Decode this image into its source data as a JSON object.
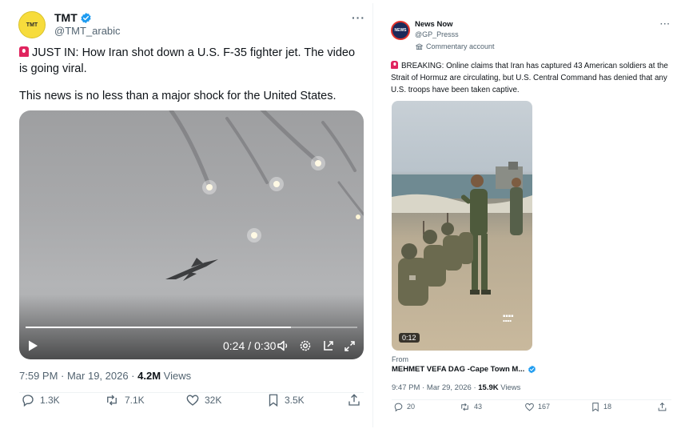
{
  "left_post": {
    "author_name": "TMT",
    "author_handle": "@TMT_arabic",
    "avatar_text": "TMT",
    "verified_color": "#1d9bf0",
    "text_line1": "JUST IN: How Iran shot down a U.S. F-35 fighter jet. The video is going viral.",
    "text_line2": "This news is no less than a major shock for the United States.",
    "video": {
      "elapsed": "0:24",
      "separator": "/",
      "duration": "0:30",
      "progress": 0.8
    },
    "timestamp": "7:59 PM · Mar 19, 2026 · ",
    "views_count": "4.2M",
    "views_label": " Views",
    "actions": {
      "replies": "1.3K",
      "reposts": "7.1K",
      "likes": "32K",
      "bookmarks": "3.5K"
    }
  },
  "right_post": {
    "author_name": "News Now",
    "author_handle": "@GP_Presss",
    "account_label": "Commentary account",
    "avatar_text": "NEWS",
    "text": "BREAKING: Online claims that Iran has captured 43 American soldiers at the Strait of Hormuz are circulating, but U.S. Central Command has denied that any U.S. troops have been taken captive.",
    "video_duration": "0:12",
    "from_label": "From",
    "from_name": "MEHMET VEFA DAG -Cape Town M...",
    "timestamp": "9:47 PM · Mar 29, 2026 · ",
    "views_count": "15.9K",
    "views_label": " Views",
    "actions": {
      "replies": "20",
      "reposts": "43",
      "likes": "167",
      "bookmarks": "18"
    }
  },
  "colors": {
    "text_primary": "#0f1419",
    "text_secondary": "#536471",
    "verified": "#1d9bf0",
    "siren": "#e0245e",
    "tmt_avatar": "#f7dc3c"
  }
}
